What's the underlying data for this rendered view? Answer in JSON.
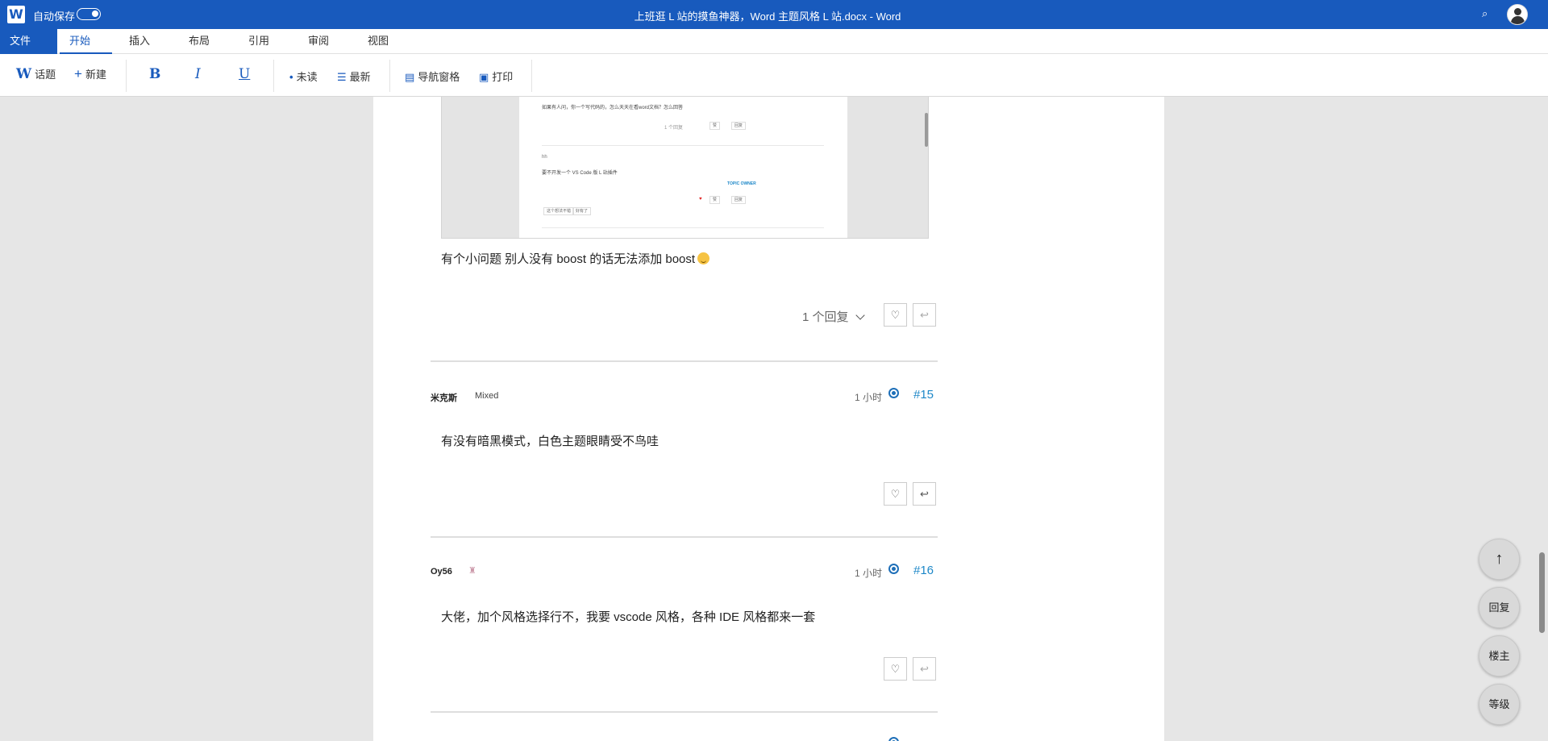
{
  "titlebar": {
    "logo": "W",
    "autosave_label": "自动保存",
    "title": "上班逛 L 站的摸鱼神器，Word 主题风格 L 站.docx - Word",
    "search_glyph": "⌕"
  },
  "menu": {
    "file": "文件",
    "tabs": [
      {
        "label": "开始",
        "active": true
      },
      {
        "label": "插入"
      },
      {
        "label": "布局"
      },
      {
        "label": "引用"
      },
      {
        "label": "审阅"
      },
      {
        "label": "视图"
      }
    ]
  },
  "ribbon": {
    "topic": {
      "icon": "W",
      "label": "话题"
    },
    "new": {
      "icon": "+",
      "label": "新建"
    },
    "bold": "B",
    "italic": "I",
    "underline": "U",
    "unread": {
      "icon": "•",
      "label": "未读"
    },
    "latest": {
      "icon": "☰",
      "label": "最新"
    },
    "nav_pane": {
      "icon": "▤",
      "label": "导航窗格"
    },
    "print": {
      "icon": "▣",
      "label": "打印"
    }
  },
  "screenshot_preview": {
    "question": "如果有人问，你一个写代码的，怎么天天在看word文档？怎么回答",
    "reply_count": "1 个回复",
    "like": "赞",
    "reply": "回复",
    "author": "hh",
    "suggestion": "要不开发一个 VS Code 版 L 站插件",
    "topic_owner": "TOPIC OWNER",
    "btn_a": "这个想法不错",
    "btn_b": "好有了"
  },
  "posts": [
    {
      "text": "有个小问题 别人没有 boost 的话无法添加 boost",
      "replies": "1 个回复",
      "like_icon": "♡",
      "reply_icon": "↩"
    },
    {
      "username": "米克斯",
      "title": "Mixed",
      "time": "1 小时",
      "number": "#15",
      "text": "有没有暗黑模式，白色主题眼睛受不鸟哇",
      "like_icon": "♡",
      "reply_icon": "↩"
    },
    {
      "username": "Oy56",
      "badge": "♜",
      "time": "1 小时",
      "number": "#16",
      "text": "大佬，加个风格选择行不，我要 vscode 风格，各种 IDE 风格都来一套",
      "like_icon": "♡",
      "reply_icon": "↩"
    }
  ],
  "floating": {
    "top_icon": "↑",
    "reply": "回复",
    "owner": "楼主",
    "level": "等级"
  }
}
